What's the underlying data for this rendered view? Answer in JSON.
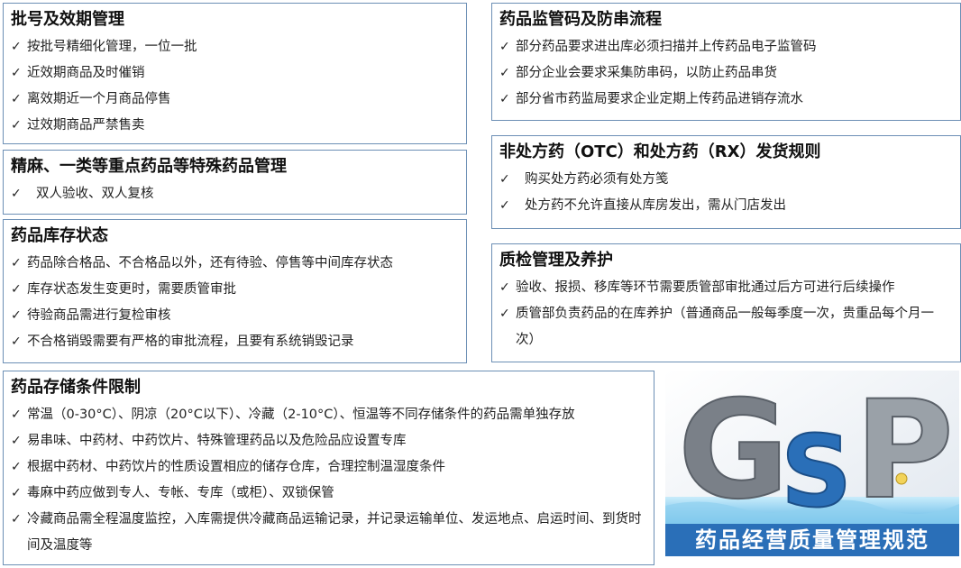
{
  "batch": {
    "title": "批号及效期管理",
    "items": [
      "按批号精细化管理，一位一批",
      "近效期商品及时催销",
      "离效期近一个月商品停售",
      "过效期商品严禁售卖"
    ]
  },
  "special": {
    "title": "精麻、一类等重点药品等特殊药品管理",
    "items": [
      "双人验收、双人复核"
    ]
  },
  "inventory": {
    "title": "药品库存状态",
    "items": [
      "药品除合格品、不合格品以外，还有待验、停售等中间库存状态",
      "库存状态发生变更时，需要质管审批",
      "待验商品需进行复检审核",
      "不合格销毁需要有严格的审批流程，且要有系统销毁记录"
    ]
  },
  "storage": {
    "title": "药品存储条件限制",
    "items": [
      "常温（0-30°C）、阴凉（20°C以下）、冷藏（2-10°C）、恒温等不同存储条件的药品需单独存放",
      "易串味、中药材、中药饮片、特殊管理药品以及危险品应设置专库",
      "根据中药材、中药饮片的性质设置相应的储存仓库，合理控制温湿度条件",
      "毒麻中药应做到专人、专帐、专库（或柜）、双锁保管",
      "冷藏商品需全程温度监控，入库需提供冷藏商品运输记录，并记录运输单位、发运地点、启运时间、到货时间及温度等"
    ]
  },
  "supervision": {
    "title": "药品监管码及防串流程",
    "items": [
      "部分药品要求进出库必须扫描并上传药品电子监管码",
      "部分企业会要求采集防串码，以防止药品串货",
      "部分省市药监局要求企业定期上传药品进销存流水"
    ]
  },
  "otc": {
    "title": "非处方药（OTC）和处方药（RX）发货规则",
    "items": [
      "购买处方药必须有处方笺",
      "处方药不允许直接从库房发出，需从门店发出"
    ]
  },
  "qc": {
    "title": "质检管理及养护",
    "items": [
      "验收、报损、移库等环节需要质管部审批通过后方可进行后续操作",
      "质管部负责药品的在库养护（普通商品一般每季度一次，贵重品每个月一次）"
    ]
  },
  "gsp": {
    "logo_text": "GSP",
    "caption": "药品经营质量管理规范",
    "colors": {
      "blue": "#2a6fb8",
      "gray": "#7a8088",
      "sky": "#9fd6f2"
    }
  },
  "check_icon": "✓"
}
